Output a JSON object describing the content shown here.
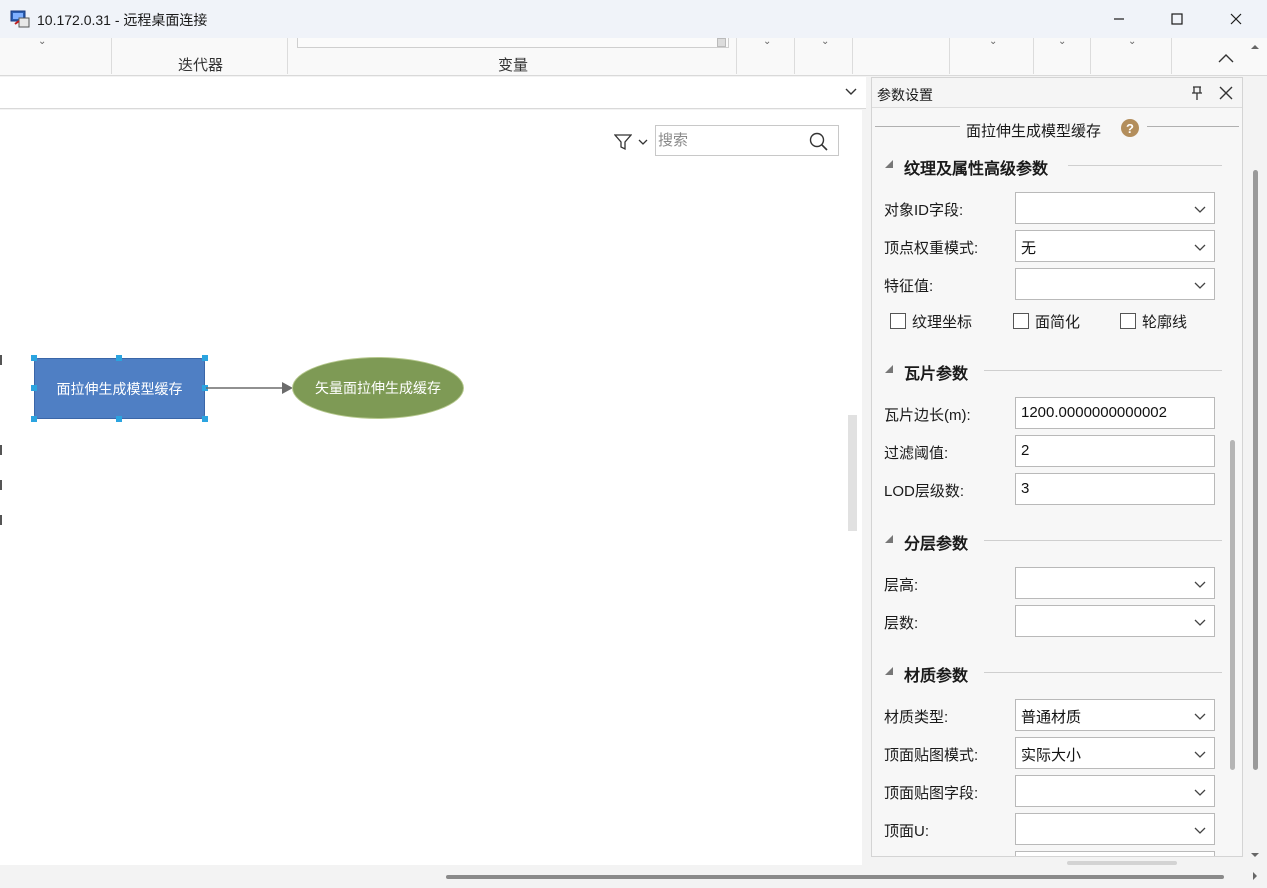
{
  "window": {
    "title": "10.172.0.31 - 远程桌面连接"
  },
  "ribbon": {
    "groups": [
      {
        "label": "迭代器"
      },
      {
        "label": "变量"
      }
    ]
  },
  "canvas": {
    "search_placeholder": "搜索",
    "nodes": [
      {
        "label": "面拉伸生成模型缓存",
        "shape": "rectangle",
        "color": "#4f7fc4",
        "selected": true
      },
      {
        "label": "矢量面拉伸生成缓存",
        "shape": "ellipse",
        "color": "#7e9a55",
        "selected": false
      }
    ]
  },
  "panel": {
    "title": "参数设置",
    "tool_title": "面拉伸生成模型缓存",
    "help_icon": "?",
    "sections": {
      "texture": {
        "title": "纹理及属性高级参数",
        "fields": [
          {
            "label": "对象ID字段:",
            "value": "",
            "type": "select"
          },
          {
            "label": "顶点权重模式:",
            "value": "无",
            "type": "select"
          },
          {
            "label": "特征值:",
            "value": "",
            "type": "select"
          }
        ],
        "checkboxes": [
          {
            "label": "纹理坐标",
            "checked": false
          },
          {
            "label": "面简化",
            "checked": false
          },
          {
            "label": "轮廓线",
            "checked": false
          }
        ]
      },
      "tile": {
        "title": "瓦片参数",
        "fields": [
          {
            "label": "瓦片边长(m):",
            "value": "1200.0000000000002",
            "type": "text"
          },
          {
            "label": "过滤阈值:",
            "value": "2",
            "type": "text"
          },
          {
            "label": "LOD层级数:",
            "value": "3",
            "type": "text"
          }
        ]
      },
      "layer": {
        "title": "分层参数",
        "fields": [
          {
            "label": "层高:",
            "value": "",
            "type": "select"
          },
          {
            "label": "层数:",
            "value": "",
            "type": "select"
          }
        ]
      },
      "material": {
        "title": "材质参数",
        "fields": [
          {
            "label": "材质类型:",
            "value": "普通材质",
            "type": "select"
          },
          {
            "label": "顶面贴图模式:",
            "value": "实际大小",
            "type": "select"
          },
          {
            "label": "顶面贴图字段:",
            "value": "",
            "type": "select"
          },
          {
            "label": "顶面U:",
            "value": "",
            "type": "select"
          }
        ]
      }
    }
  }
}
